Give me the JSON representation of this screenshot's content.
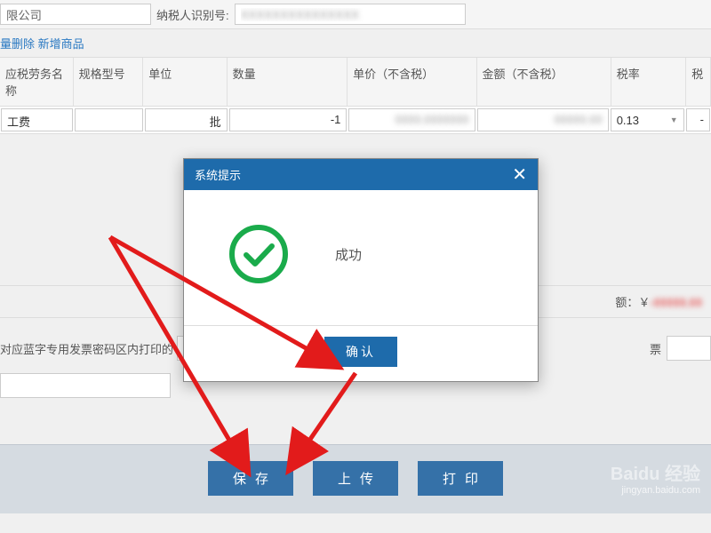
{
  "topForm": {
    "company_suffix": "限公司",
    "tax_id_label": "纳税人识别号:",
    "tax_id_value": ""
  },
  "linkRow": {
    "batch_delete": "量删除",
    "add_product": "新增商品"
  },
  "table": {
    "headers": {
      "name": "应税劳务名称",
      "spec": "规格型号",
      "unit": "单位",
      "qty": "数量",
      "price": "单价（不含税）",
      "amount": "金额（不含税）",
      "rate": "税率",
      "tax": "税"
    },
    "row": {
      "name": "工费",
      "spec": "",
      "unit": "批",
      "qty": "-1",
      "price": "",
      "amount": "",
      "rate": "0.13",
      "tax": "-"
    }
  },
  "remain": {
    "label": "额：￥",
    "value": "-"
  },
  "blueLabel": {
    "prefix": "对应蓝字专用发票密码区内打印的",
    "suffix": "票"
  },
  "bottomButtons": {
    "save": "保存",
    "upload": "上传",
    "print": "打印"
  },
  "modal": {
    "title": "系统提示",
    "message": "成功",
    "confirm": "确认"
  },
  "watermark": {
    "brand": "Baidu 经验",
    "url": "jingyan.baidu.com"
  }
}
